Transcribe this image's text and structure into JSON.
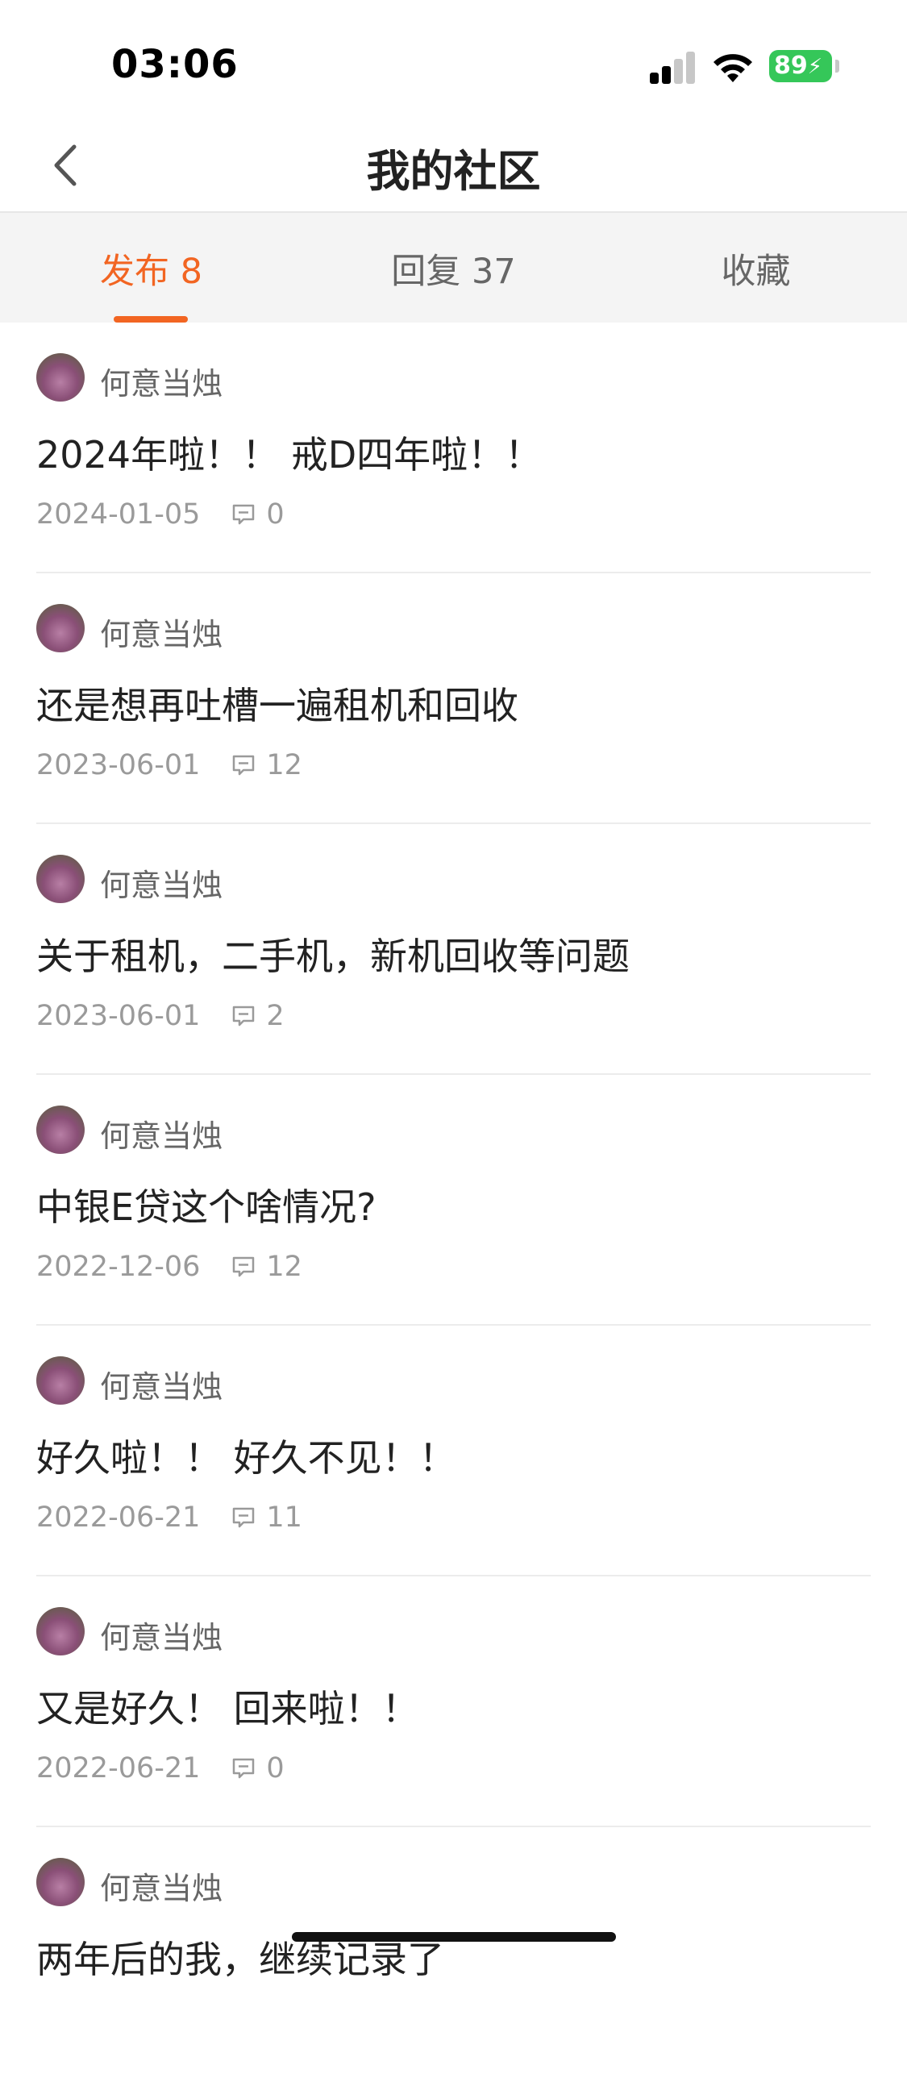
{
  "status_bar": {
    "time": "03:06",
    "battery": "89"
  },
  "nav": {
    "title": "我的社区",
    "back_icon": "chevron-left-icon"
  },
  "tabs": [
    {
      "label": "发布 8",
      "active": true
    },
    {
      "label": "回复 37",
      "active": false
    },
    {
      "label": "收藏",
      "active": false
    }
  ],
  "colors": {
    "accent": "#f26522",
    "battery": "#35c759"
  },
  "posts": [
    {
      "author": "何意当烛",
      "title": "2024年啦！！ 戒D四年啦！！",
      "date": "2024-01-05",
      "comments": "0"
    },
    {
      "author": "何意当烛",
      "title": "还是想再吐槽一遍租机和回收",
      "date": "2023-06-01",
      "comments": "12"
    },
    {
      "author": "何意当烛",
      "title": "关于租机，二手机，新机回收等问题",
      "date": "2023-06-01",
      "comments": "2"
    },
    {
      "author": "何意当烛",
      "title": "中银E贷这个啥情况?",
      "date": "2022-12-06",
      "comments": "12"
    },
    {
      "author": "何意当烛",
      "title": "好久啦！！ 好久不见！！",
      "date": "2022-06-21",
      "comments": "11"
    },
    {
      "author": "何意当烛",
      "title": "又是好久！ 回来啦！！",
      "date": "2022-06-21",
      "comments": "0"
    },
    {
      "author": "何意当烛",
      "title": "两年后的我，继续记录了",
      "date": "",
      "comments": ""
    }
  ]
}
